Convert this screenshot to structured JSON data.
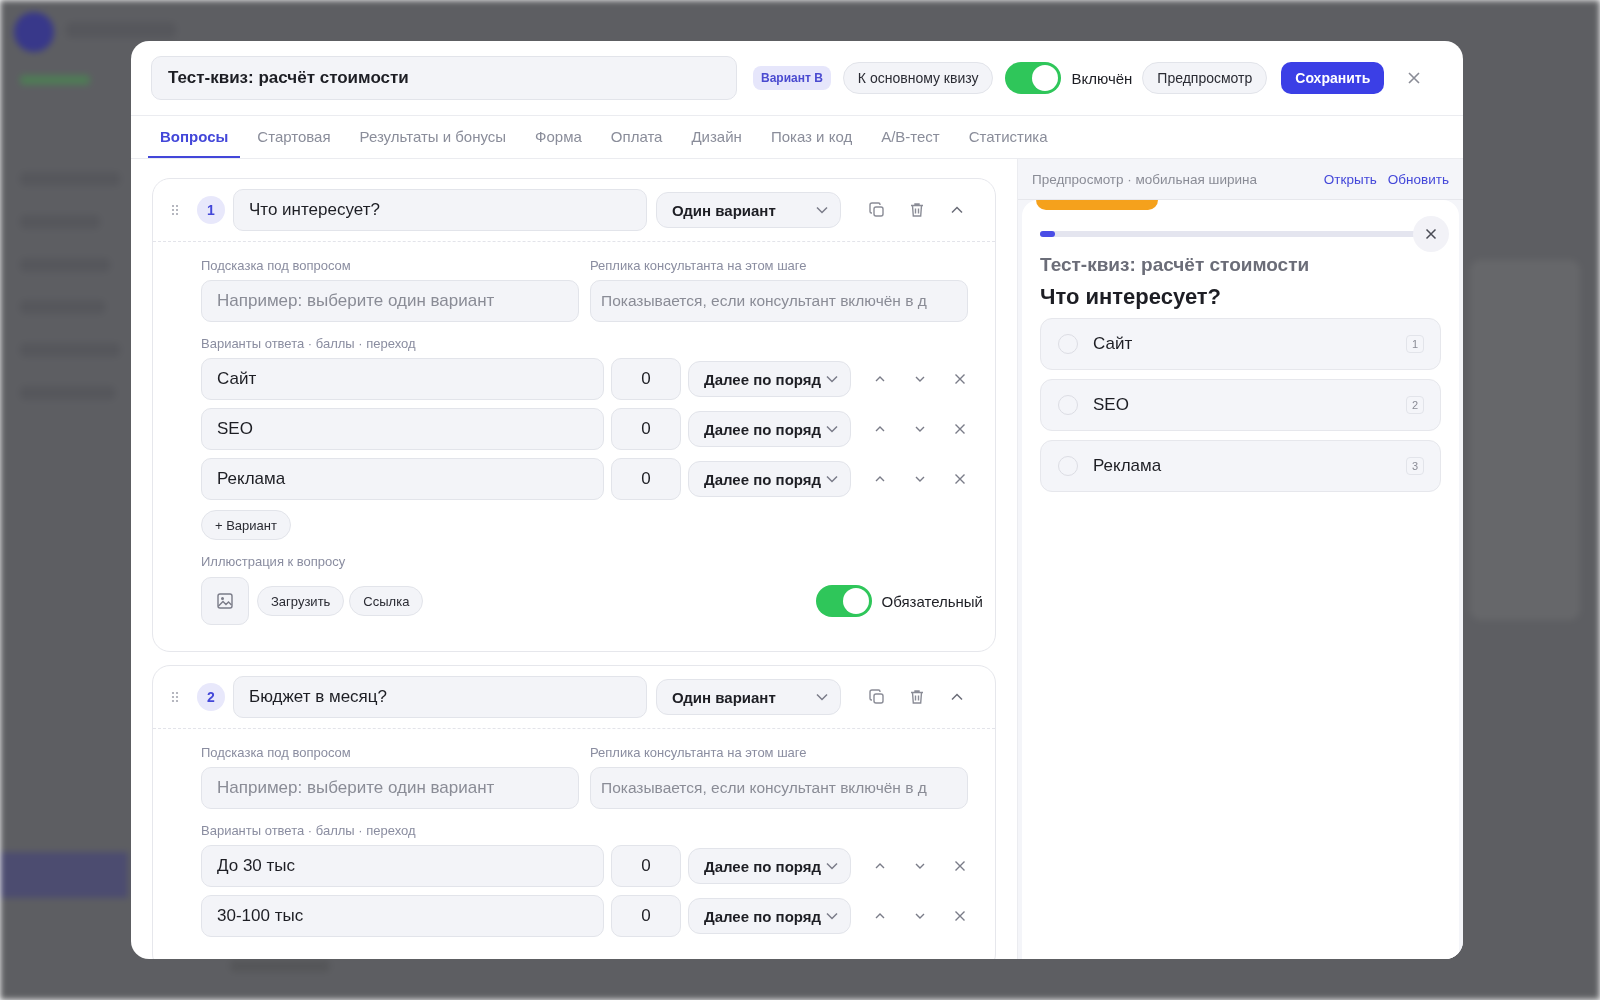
{
  "header": {
    "title_value": "Тест-квиз: расчёт стоимости",
    "variant_badge": "Вариант B",
    "back_button": "К основному квизу",
    "enabled": {
      "on": true,
      "label": "Включён"
    },
    "preview_button": "Предпросмотр",
    "save_button": "Сохранить"
  },
  "tabs": [
    {
      "label": "Вопросы",
      "selected": true
    },
    {
      "label": "Стартовая",
      "selected": false
    },
    {
      "label": "Результаты и бонусы",
      "selected": false
    },
    {
      "label": "Форма",
      "selected": false
    },
    {
      "label": "Оплата",
      "selected": false
    },
    {
      "label": "Дизайн",
      "selected": false
    },
    {
      "label": "Показ и код",
      "selected": false
    },
    {
      "label": "A/B-тест",
      "selected": false
    },
    {
      "label": "Статистика",
      "selected": false
    }
  ],
  "questions": [
    {
      "number": "1",
      "title": "Что интересует?",
      "type": "Один вариант",
      "expanded": true,
      "hint_label": "Подсказка под вопросом",
      "hint_placeholder": "Например: выберите один вариант",
      "consultant_label": "Реплика консультанта на этом шаге",
      "consultant_placeholder": "Показывается, если консультант включён в д",
      "answers_label": "Варианты ответа · баллы · переход",
      "answers": [
        {
          "text": "Сайт",
          "score": "0",
          "jump": "Далее по поряд"
        },
        {
          "text": "SEO",
          "score": "0",
          "jump": "Далее по поряд"
        },
        {
          "text": "Реклама",
          "score": "0",
          "jump": "Далее по поряд"
        }
      ],
      "add_button": "+ Вариант",
      "illustration_label": "Иллюстрация к вопросу",
      "upload_button": "Загрузить",
      "link_button": "Ссылка",
      "required": {
        "on": true,
        "label": "Обязательный"
      }
    },
    {
      "number": "2",
      "title": "Бюджет в месяц?",
      "type": "Один вариант",
      "expanded": true,
      "hint_label": "Подсказка под вопросом",
      "hint_placeholder": "Например: выберите один вариант",
      "consultant_label": "Реплика консультанта на этом шаге",
      "consultant_placeholder": "Показывается, если консультант включён в д",
      "answers_label": "Варианты ответа · баллы · переход",
      "answers": [
        {
          "text": "До 30 тыс",
          "score": "0",
          "jump": "Далее по поряд"
        },
        {
          "text": "30-100 тыс",
          "score": "0",
          "jump": "Далее по поряд"
        }
      ]
    }
  ],
  "preview": {
    "label": "Предпросмотр · мобильная ширина",
    "open_link": "Открыть",
    "refresh_link": "Обновить",
    "progress": {
      "level": 0.04
    },
    "quiz_title": "Тест-квиз: расчёт стоимости",
    "question": "Что интересует?",
    "options": [
      {
        "text": "Сайт",
        "key": "1",
        "selected": false
      },
      {
        "text": "SEO",
        "key": "2",
        "selected": false
      },
      {
        "text": "Реклама",
        "key": "3",
        "selected": false
      }
    ]
  }
}
